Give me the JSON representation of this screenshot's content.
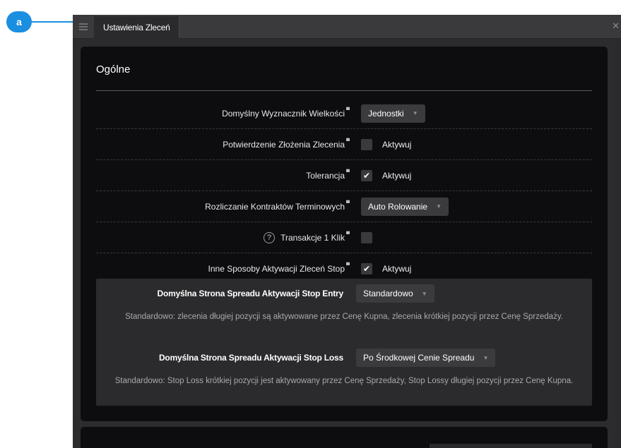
{
  "annotation": {
    "label": "a",
    "color": "#1a8ee0"
  },
  "window": {
    "tab_label": "Ustawienia Zleceń"
  },
  "general": {
    "title": "Ogólne",
    "rows": [
      {
        "label": "Domyślny Wyznacznik Wielkości",
        "type": "select",
        "value": "Jednostki"
      },
      {
        "label": "Potwierdzenie Złożenia Zlecenia",
        "type": "checkbox",
        "checked": false,
        "check_label": "Aktywuj"
      },
      {
        "label": "Tolerancja",
        "type": "checkbox",
        "checked": true,
        "check_label": "Aktywuj"
      },
      {
        "label": "Rozliczanie Kontraktów Terminowych",
        "type": "select",
        "value": "Auto Rolowanie"
      },
      {
        "label": "Transakcje 1 Klik",
        "type": "checkbox",
        "checked": false,
        "check_label": "",
        "help": true
      },
      {
        "label": "Inne Sposoby Aktywacji Zleceń Stop",
        "type": "checkbox",
        "checked": true,
        "check_label": "Aktywuj"
      }
    ]
  },
  "stop_settings": {
    "entry_label": "Domyślna Strona Spreadu Aktywacji Stop Entry",
    "entry_value": "Standardowo",
    "entry_desc": "Standardowo: zlecenia długiej pozycji są aktywowane przez Cenę Kupna, zlecenia krótkiej pozycji przez Cenę Sprzedaży.",
    "loss_label": "Domyślna Strona Spreadu Aktywacji Stop Loss",
    "loss_value": "Po Środkowej Cenie Spreadu",
    "loss_desc": "Standardowo: Stop Loss krótkiej pozycji jest aktywowany przez Cenę Sprzedaży, Stop Lossy długiej pozycji przez Cenę Kupna."
  },
  "icons": {
    "menu": "hamburger-icon",
    "close": "close-icon",
    "caret": "chevron-down-icon",
    "check": "checkmark-icon",
    "help": "question-circle-icon"
  }
}
